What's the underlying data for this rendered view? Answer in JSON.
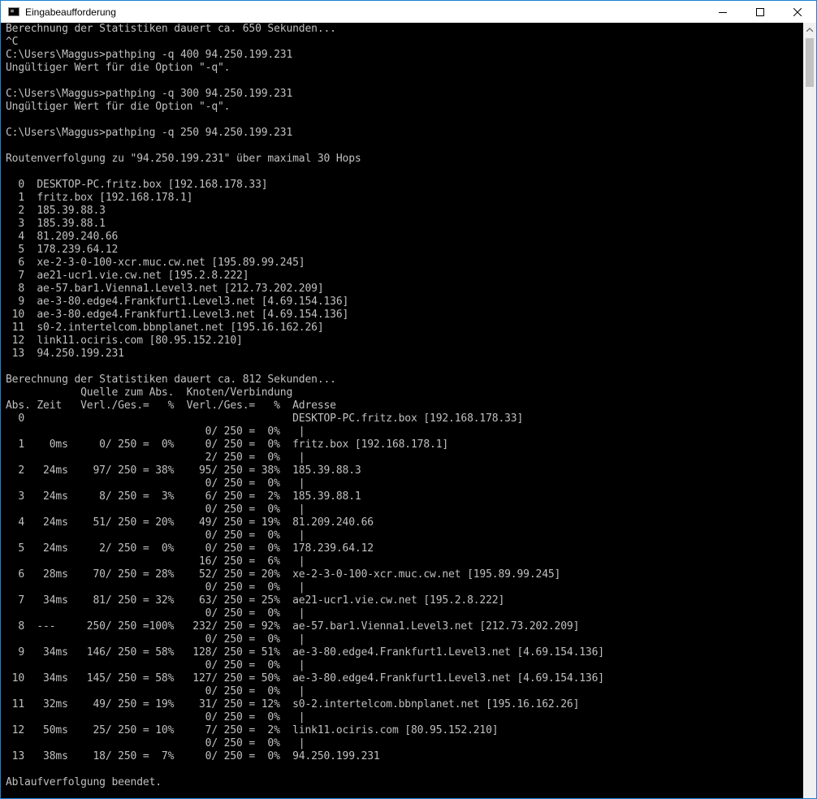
{
  "window": {
    "title": "Eingabeaufforderung",
    "accent": "#1883d7",
    "icon": "cmd-icon",
    "controls": [
      "minimize-icon",
      "maximize-icon",
      "close-icon"
    ]
  },
  "console": {
    "background": "#000000",
    "foreground": "#c0c0c0",
    "lines": [
      "Berechnung der Statistiken dauert ca. 650 Sekunden...",
      "^C",
      "C:\\Users\\Maggus>pathping -q 400 94.250.199.231",
      "Ungültiger Wert für die Option \"-q\".",
      "",
      "C:\\Users\\Maggus>pathping -q 300 94.250.199.231",
      "Ungültiger Wert für die Option \"-q\".",
      "",
      "C:\\Users\\Maggus>pathping -q 250 94.250.199.231",
      "",
      "Routenverfolgung zu \"94.250.199.231\" über maximal 30 Hops",
      "",
      "  0  DESKTOP-PC.fritz.box [192.168.178.33]",
      "  1  fritz.box [192.168.178.1]",
      "  2  185.39.88.3",
      "  3  185.39.88.1",
      "  4  81.209.240.66",
      "  5  178.239.64.12",
      "  6  xe-2-3-0-100-xcr.muc.cw.net [195.89.99.245]",
      "  7  ae21-ucr1.vie.cw.net [195.2.8.222]",
      "  8  ae-57.bar1.Vienna1.Level3.net [212.73.202.209]",
      "  9  ae-3-80.edge4.Frankfurt1.Level3.net [4.69.154.136]",
      " 10  ae-3-80.edge4.Frankfurt1.Level3.net [4.69.154.136]",
      " 11  s0-2.intertelcom.bbnplanet.net [195.16.162.26]",
      " 12  link11.ociris.com [80.95.152.210]",
      " 13  94.250.199.231",
      "",
      "Berechnung der Statistiken dauert ca. 812 Sekunden...",
      "            Quelle zum Abs.  Knoten/Verbindung",
      "Abs. Zeit   Verl./Ges.=   %  Verl./Ges.=   %  Adresse",
      "  0                                           DESKTOP-PC.fritz.box [192.168.178.33]",
      "                                0/ 250 =  0%   |",
      "  1    0ms     0/ 250 =  0%     0/ 250 =  0%  fritz.box [192.168.178.1]",
      "                                2/ 250 =  0%   |",
      "  2   24ms    97/ 250 = 38%    95/ 250 = 38%  185.39.88.3",
      "                                0/ 250 =  0%   |",
      "  3   24ms     8/ 250 =  3%     6/ 250 =  2%  185.39.88.1",
      "                                0/ 250 =  0%   |",
      "  4   24ms    51/ 250 = 20%    49/ 250 = 19%  81.209.240.66",
      "                                0/ 250 =  0%   |",
      "  5   24ms     2/ 250 =  0%     0/ 250 =  0%  178.239.64.12",
      "                               16/ 250 =  6%   |",
      "  6   28ms    70/ 250 = 28%    52/ 250 = 20%  xe-2-3-0-100-xcr.muc.cw.net [195.89.99.245]",
      "                                0/ 250 =  0%   |",
      "  7   34ms    81/ 250 = 32%    63/ 250 = 25%  ae21-ucr1.vie.cw.net [195.2.8.222]",
      "                                0/ 250 =  0%   |",
      "  8  ---     250/ 250 =100%   232/ 250 = 92%  ae-57.bar1.Vienna1.Level3.net [212.73.202.209]",
      "                                0/ 250 =  0%   |",
      "  9   34ms   146/ 250 = 58%   128/ 250 = 51%  ae-3-80.edge4.Frankfurt1.Level3.net [4.69.154.136]",
      "                                0/ 250 =  0%   |",
      " 10   34ms   145/ 250 = 58%   127/ 250 = 50%  ae-3-80.edge4.Frankfurt1.Level3.net [4.69.154.136]",
      "                                0/ 250 =  0%   |",
      " 11   32ms    49/ 250 = 19%    31/ 250 = 12%  s0-2.intertelcom.bbnplanet.net [195.16.162.26]",
      "                                0/ 250 =  0%   |",
      " 12   50ms    25/ 250 = 10%     7/ 250 =  2%  link11.ociris.com [80.95.152.210]",
      "                                0/ 250 =  0%   |",
      " 13   38ms    18/ 250 =  7%     0/ 250 =  0%  94.250.199.231",
      "",
      "Ablaufverfolgung beendet."
    ]
  }
}
